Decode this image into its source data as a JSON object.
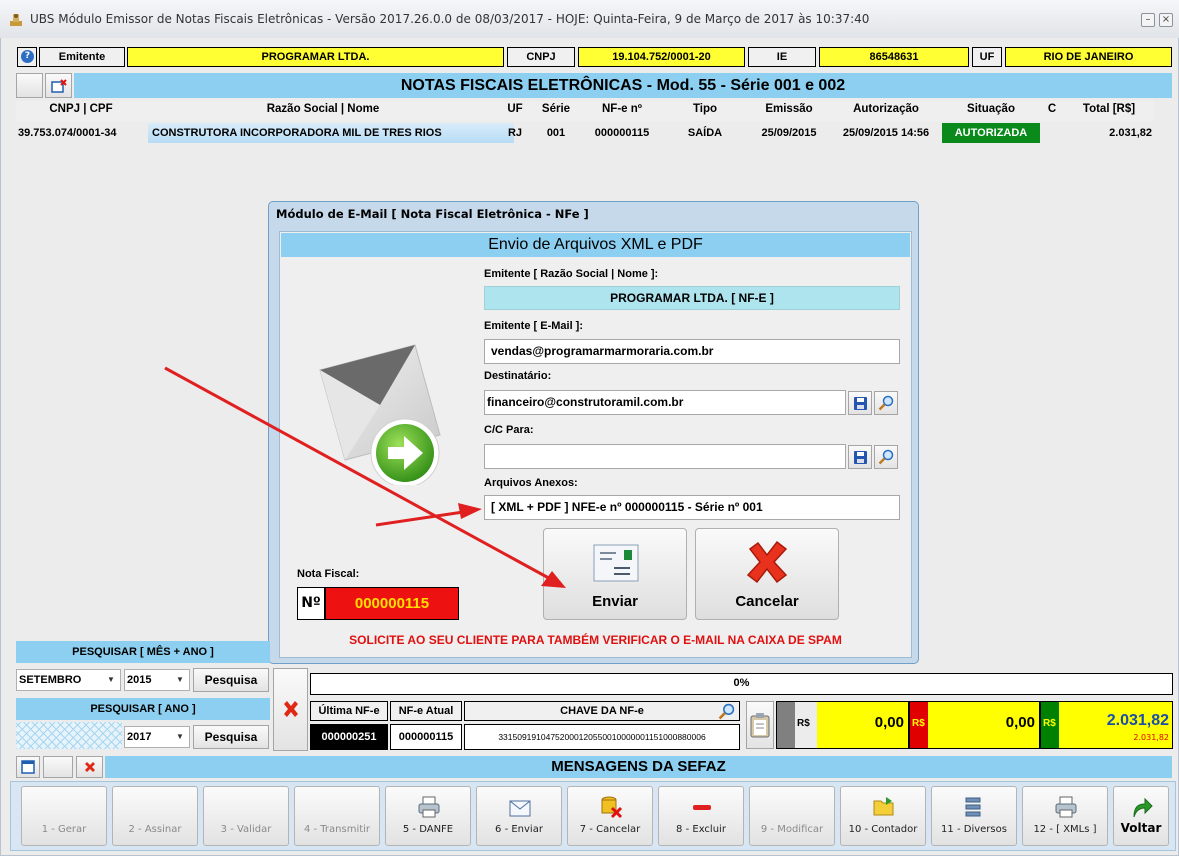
{
  "window": {
    "title": "UBS Módulo Emissor de Notas Fiscais Eletrônicas - Versão 2017.26.0.0 de 08/03/2017 - HOJE: Quinta-Feira, 9 de Março de 2017 às 10:37:40",
    "min_label": "–",
    "close_label": "×"
  },
  "info_bar": {
    "help_label": "?",
    "emitente_label": "Emitente",
    "emitente_value": "PROGRAMAR LTDA.",
    "cnpj_label": "CNPJ",
    "cnpj_value": "19.104.752/0001-20",
    "ie_label": "IE",
    "ie_value": "86548631",
    "uf_label": "UF",
    "uf_value": "RIO DE JANEIRO"
  },
  "section_title": "NOTAS FISCAIS ELETRÔNICAS - Mod. 55 - Série 001 e 002",
  "table": {
    "headers": [
      "CNPJ | CPF",
      "Razão Social | Nome",
      "UF",
      "Série",
      "NF-e nº",
      "Tipo",
      "Emissão",
      "Autorização",
      "Situação",
      "C",
      "Total [R$]"
    ],
    "rows": [
      [
        "39.753.074/0001-34",
        "CONSTRUTORA INCORPORADORA MIL DE TRES RIOS",
        "RJ",
        "001",
        "000000115",
        "SAÍDA",
        "25/09/2015",
        "25/09/2015 14:56",
        "AUTORIZADA",
        "",
        "2.031,82"
      ]
    ]
  },
  "dialog": {
    "title": "Módulo de E-Mail [ Nota Fiscal Eletrônica - NFe ]",
    "header": "Envio de Arquivos XML e PDF",
    "emitente_label": "Emitente [ Razão Social | Nome ]:",
    "emitente_value": "PROGRAMAR LTDA. [ NF-E ]",
    "email_label": "Emitente [ E-Mail ]:",
    "email_value": "vendas@programarmarmoraria.com.br",
    "dest_label": "Destinatário:",
    "dest_value": "financeiro@construtoramil.com.br",
    "cc_label": "C/C Para:",
    "cc_value": "",
    "anexos_label": "Arquivos Anexos:",
    "anexos_value": "[ XML + PDF ] NFE-e nº 000000115 - Série nº 001",
    "nota_label": "Nota Fiscal:",
    "nota_prefix": "Nº",
    "nota_value": "000000115",
    "send_label": "Enviar",
    "cancel_label": "Cancelar",
    "warning": "SOLICITE AO SEU CLIENTE PARA TAMBÉM VERIFICAR O E-MAIL NA CAIXA DE SPAM"
  },
  "search": {
    "mes_ano_title": "PESQUISAR [ MÊS + ANO ]",
    "month": "SETEMBRO",
    "year": "2015",
    "search_label": "Pesquisa",
    "ano_title": "PESQUISAR [ ANO ]",
    "year2": "2017",
    "search2_label": "Pesquisa"
  },
  "progress": {
    "text": "0%",
    "value": 0
  },
  "nfe_info": {
    "ultima_label": "Última NF-e",
    "atual_label": "NF-e Atual",
    "chave_label": "CHAVE DA NF-e",
    "ultima_value": "000000251",
    "atual_value": "000000115",
    "chave_value": "33150919104752000120550010000001151000880006"
  },
  "totals": [
    {
      "label": "R$",
      "value": "0,00",
      "color": "#ffff00",
      "tag_color": "#808080"
    },
    {
      "label": "R$",
      "value": "0,00",
      "color": "#ffff00",
      "tag_color": "#e00000"
    },
    {
      "label": "R$",
      "value": "2.031,82",
      "sub": "2.031,82",
      "color": "#ffff00",
      "tag_color": "#008000"
    }
  ],
  "mensagens_title": "MENSAGENS DA SEFAZ",
  "toolbar": [
    {
      "label": "1 - Gerar",
      "icon": "gear-icon",
      "enabled": false
    },
    {
      "label": "2 - Assinar",
      "icon": "sign-icon",
      "enabled": false
    },
    {
      "label": "3 - Validar",
      "icon": "validate-icon",
      "enabled": false
    },
    {
      "label": "4 - Transmitir",
      "icon": "transmit-icon",
      "enabled": false
    },
    {
      "label": "5 - DANFE",
      "icon": "printer-icon",
      "enabled": true
    },
    {
      "label": "6 - Enviar",
      "icon": "envelope-icon",
      "enabled": true
    },
    {
      "label": "7 - Cancelar",
      "icon": "cancel-db-icon",
      "enabled": true
    },
    {
      "label": "8 - Excluir",
      "icon": "minus-icon",
      "enabled": true
    },
    {
      "label": "9 - Modificar",
      "icon": "edit-icon",
      "enabled": false
    },
    {
      "label": "10 - Contador",
      "icon": "folder-icon",
      "enabled": true
    },
    {
      "label": "11 - Diversos",
      "icon": "list-icon",
      "enabled": true
    },
    {
      "label": "12 - [ XMLs ]",
      "icon": "printer-icon",
      "enabled": true
    },
    {
      "label": "Voltar",
      "icon": "back-arrow-icon",
      "enabled": true
    }
  ]
}
